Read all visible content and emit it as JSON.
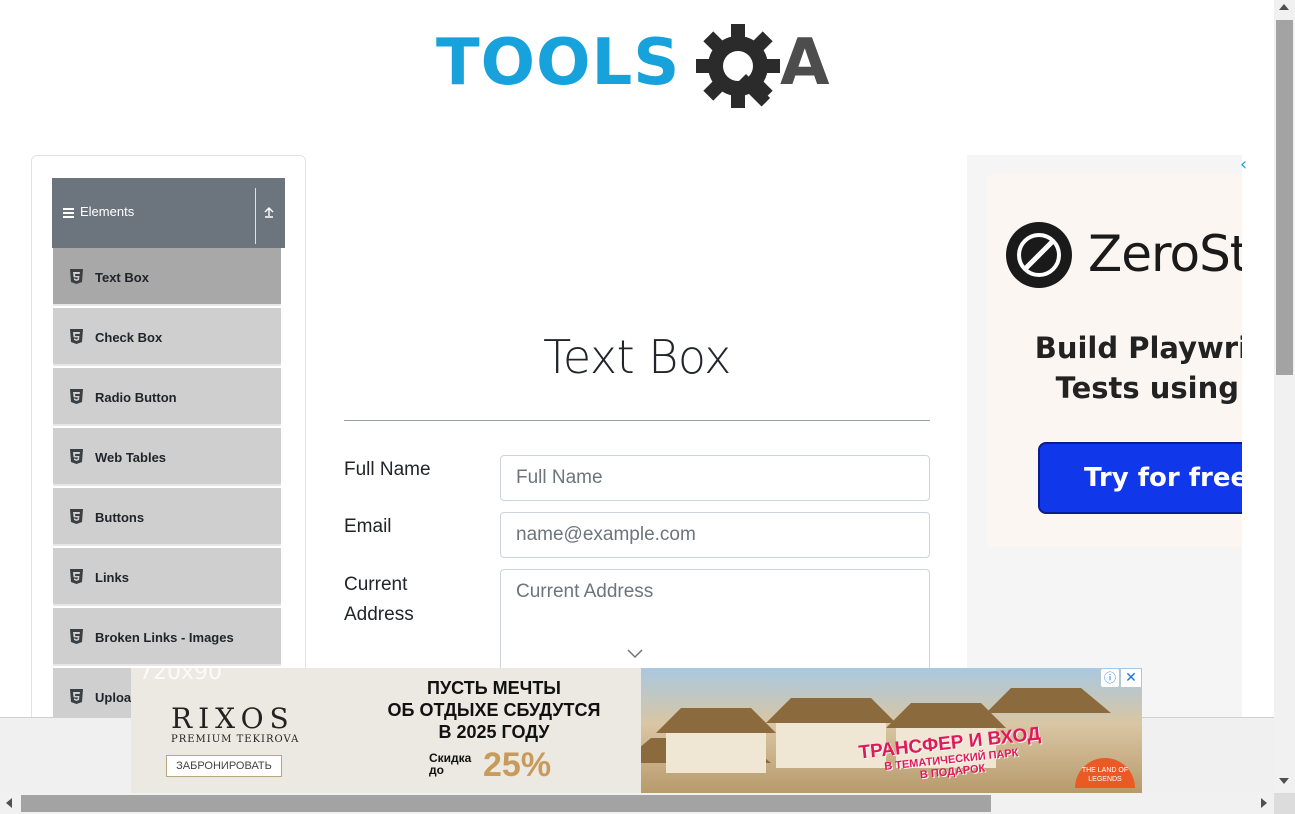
{
  "logo": {
    "text": "TOOLS",
    "suffix": "A",
    "brand_color": "#17a2dc",
    "gear_color": "#2b2b2b"
  },
  "sidebar": {
    "group_label": "Elements",
    "header_color": "#6c757d",
    "items": [
      {
        "label": "Text Box",
        "active": true
      },
      {
        "label": "Check Box"
      },
      {
        "label": "Radio Button"
      },
      {
        "label": "Web Tables"
      },
      {
        "label": "Buttons"
      },
      {
        "label": "Links"
      },
      {
        "label": "Broken Links - Images"
      },
      {
        "label": "Upload and Download"
      }
    ]
  },
  "main": {
    "title": "Text Box",
    "fields": {
      "full_name": {
        "label": "Full Name",
        "placeholder": "Full Name",
        "value": ""
      },
      "email": {
        "label": "Email",
        "placeholder": "name@example.com",
        "value": ""
      },
      "current_address": {
        "label_line1": "Current",
        "label_line2": "Address",
        "placeholder": "Current Address",
        "value": ""
      }
    }
  },
  "right_ad": {
    "brand": "ZeroStep",
    "tagline_line1": "Build Playwright",
    "tagline_line2": "Tests using AI",
    "cta": "Try for free →",
    "cta_color": "#1038ea"
  },
  "bottom_ad": {
    "size_label": "720x90",
    "brand": "RIXOS",
    "brand_sub": "PREMIUM TEKIROVA",
    "book_button": "ЗАБРОНИРОВАТЬ",
    "headline_line1": "ПУСТЬ МЕЧТЫ",
    "headline_line2": "ОБ ОТДЫХЕ СБУДУТСЯ",
    "headline_line3": "В 2025 ГОДУ",
    "discount_line1": "Скидка",
    "discount_line2": "до",
    "discount_value": "25%",
    "promo_line1": "ТРАНСФЕР И ВХОД",
    "promo_line2": "В ТЕМАТИЧЕСКИЙ ПАРК",
    "promo_line3": "В ПОДАРОК",
    "partner_line1": "THE LAND OF",
    "partner_line2": "LEGENDS",
    "info_icon": "info-icon",
    "close_icon": "close-icon"
  }
}
